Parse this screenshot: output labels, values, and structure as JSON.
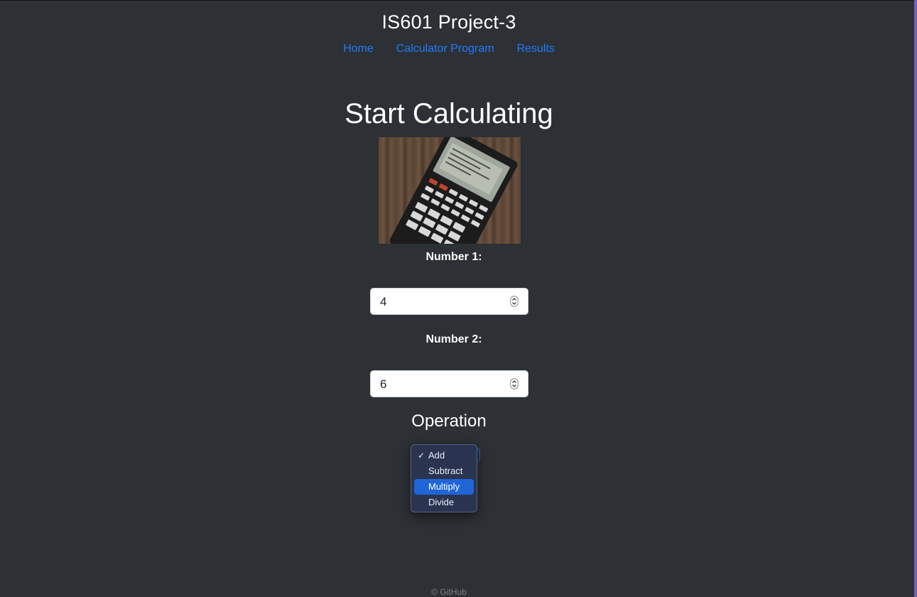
{
  "header": {
    "title": "IS601 Project-3",
    "nav": [
      {
        "label": "Home"
      },
      {
        "label": "Calculator Program"
      },
      {
        "label": "Results"
      }
    ]
  },
  "main": {
    "heading": "Start Calculating",
    "image_icon": "calculator-photo",
    "number1": {
      "label": "Number 1:",
      "value": "4"
    },
    "number2": {
      "label": "Number 2:",
      "value": "6"
    },
    "operation": {
      "label": "Operation",
      "selected": "Add",
      "highlighted": "Multiply",
      "options": [
        "Add",
        "Subtract",
        "Multiply",
        "Divide"
      ]
    }
  },
  "footer": {
    "text": "© GitHub"
  },
  "colors": {
    "background": "#2d3034",
    "link": "#1f7bff",
    "dropdown_bg": "#2a3450",
    "dropdown_highlight": "#1f65d6"
  }
}
